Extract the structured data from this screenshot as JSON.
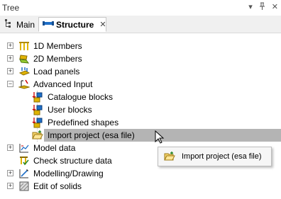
{
  "panel": {
    "title": "Tree",
    "menu_glyph": "▾",
    "pin_glyph": "ᵽ",
    "close_glyph": "✕"
  },
  "tabs": [
    {
      "label": "Main"
    },
    {
      "label": "Structure",
      "close": "✕"
    }
  ],
  "tree": {
    "items": [
      {
        "label": "1D Members",
        "expander": "+",
        "icon": "1d-members-icon"
      },
      {
        "label": "2D Members",
        "expander": "+",
        "icon": "2d-members-icon"
      },
      {
        "label": "Load panels",
        "expander": "+",
        "icon": "load-panels-icon"
      },
      {
        "label": "Advanced Input",
        "expander": "−",
        "icon": "advanced-input-icon"
      },
      {
        "label": "Catalogue blocks",
        "icon": "block-icon"
      },
      {
        "label": "User blocks",
        "icon": "block-icon"
      },
      {
        "label": "Predefined shapes",
        "icon": "block-icon"
      },
      {
        "label": "Import project (esa file)",
        "icon": "open-folder-icon",
        "selected": true
      },
      {
        "label": "Model data",
        "expander": "+",
        "icon": "model-data-icon"
      },
      {
        "label": "Check structure data",
        "icon": "check-data-icon"
      },
      {
        "label": "Modelling/Drawing",
        "expander": "+",
        "icon": "modelling-icon"
      },
      {
        "label": "Edit of solids",
        "expander": "+",
        "icon": "solids-icon"
      }
    ]
  },
  "tooltip": {
    "label": "Import project (esa file)",
    "icon": "open-folder-icon"
  },
  "colors": {
    "selection": "#b4b4b4",
    "tab_active": "#ffffff",
    "tab_bar": "#f0f0f0"
  }
}
